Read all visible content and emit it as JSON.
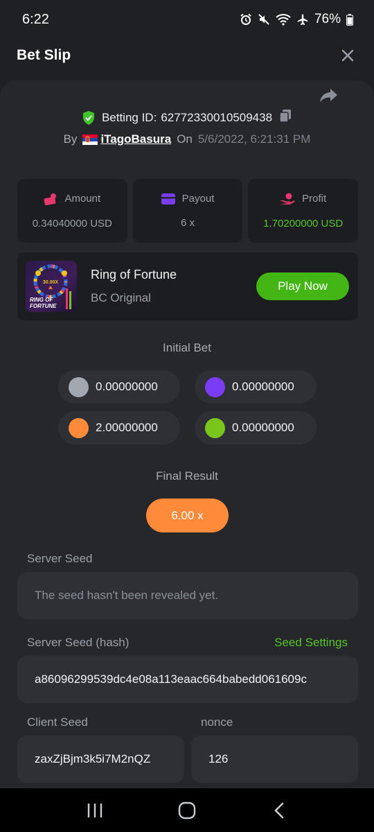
{
  "status": {
    "time": "6:22",
    "battery": "76%",
    "icons": [
      "alarm-icon",
      "mute-icon",
      "wifi-icon",
      "airplane-icon",
      "battery-icon"
    ]
  },
  "header": {
    "title": "Bet Slip"
  },
  "bet": {
    "betting_id_label": "Betting ID:",
    "betting_id": "62772330010509438",
    "by_label": "By",
    "username": "iTagoBasura",
    "on_label": "On",
    "date": "5/6/2022, 6:21:31 PM"
  },
  "stats": {
    "amount_label": "Amount",
    "amount_value": "0.34040000 USD",
    "payout_label": "Payout",
    "payout_value": "6 x",
    "profit_label": "Profit",
    "profit_value": "1.70200000 USD"
  },
  "game": {
    "thumb_text_top": "30.00X",
    "thumb_text_1": "RING OF",
    "thumb_text_2": "FORTUNE",
    "name": "Ring of Fortune",
    "provider": "BC Original",
    "play_label": "Play Now"
  },
  "initial_bet": {
    "title": "Initial Bet",
    "chips": [
      {
        "color": "#a3a8b0",
        "value": "0.00000000"
      },
      {
        "color": "#7b3cf5",
        "value": "0.00000000"
      },
      {
        "color": "#ff8a3a",
        "value": "2.00000000"
      },
      {
        "color": "#7ac51c",
        "value": "0.00000000"
      }
    ]
  },
  "final_result": {
    "title": "Final Result",
    "value": "6.00 x"
  },
  "seeds": {
    "server_seed_label": "Server Seed",
    "server_seed_value": "The seed hasn't been revealed yet.",
    "server_hash_label": "Server Seed (hash)",
    "seed_settings_label": "Seed Settings",
    "server_hash_value": "a86096299539dc4e08a113eaac664babedd061609c",
    "client_seed_label": "Client Seed",
    "client_seed_value": "zaxZjBjm3k5i7M2nQZ",
    "nonce_label": "nonce",
    "nonce_value": "126"
  },
  "colors": {
    "accent_green": "#57c42b",
    "button_green": "#43b515",
    "result_orange": "#ff8a3a",
    "background": "#1f2023",
    "card": "#26272b"
  }
}
